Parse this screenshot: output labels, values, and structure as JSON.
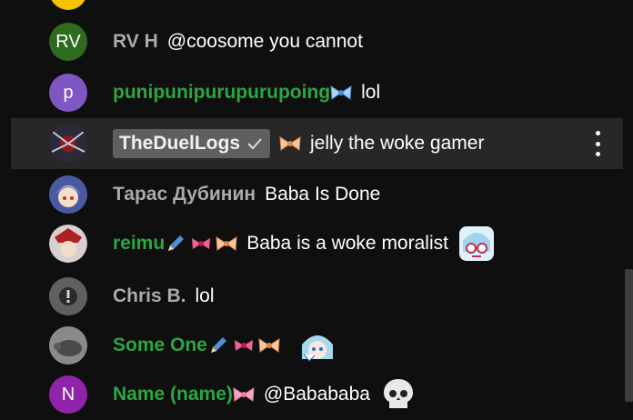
{
  "colors": {
    "background": "#0f0f0f",
    "hover_row": "#272727",
    "member_name": "#2ba640",
    "regular_name": "#aaaaaa",
    "owner_chip": "#5f5f5f"
  },
  "messages": [
    {
      "avatar_text": "",
      "avatar_color": "#f5c400",
      "author": "",
      "text": ""
    },
    {
      "avatar_text": "RV",
      "avatar_color": "#2e6b1f",
      "author": "RV H",
      "text": "@coosome you cannot"
    },
    {
      "avatar_text": "p",
      "avatar_color": "#7e57c2",
      "author": "punipunipurupurupoing",
      "text": "lol"
    },
    {
      "avatar_text": "",
      "avatar_color": "#1e1e2a",
      "author": "TheDuelLogs",
      "text": "jelly the woke gamer"
    },
    {
      "avatar_text": "",
      "avatar_color": "#3a4a86",
      "author": "Тарас Дубинин",
      "text": "Baba Is Done"
    },
    {
      "avatar_text": "",
      "avatar_color": "#5a2a2a",
      "author": "reimu",
      "text": "Baba is a woke moralist"
    },
    {
      "avatar_text": "!",
      "avatar_color": "#606060",
      "author": "Chris B.",
      "text": "lol"
    },
    {
      "avatar_text": "",
      "avatar_color": "#6a6a6a",
      "author": "Some One",
      "text": ""
    },
    {
      "avatar_text": "N",
      "avatar_color": "#8e24aa",
      "author": "Name (name)",
      "text": "@Babababa"
    }
  ],
  "icons": {
    "member_badge": "bow-ribbon-icon",
    "verified": "checkmark-icon",
    "pencil": "pencil-icon",
    "ribbon": "pink-ribbon-icon",
    "menu": "more-vertical-icon",
    "skull": "skull-icon",
    "character_emote": "character-emote-icon"
  }
}
